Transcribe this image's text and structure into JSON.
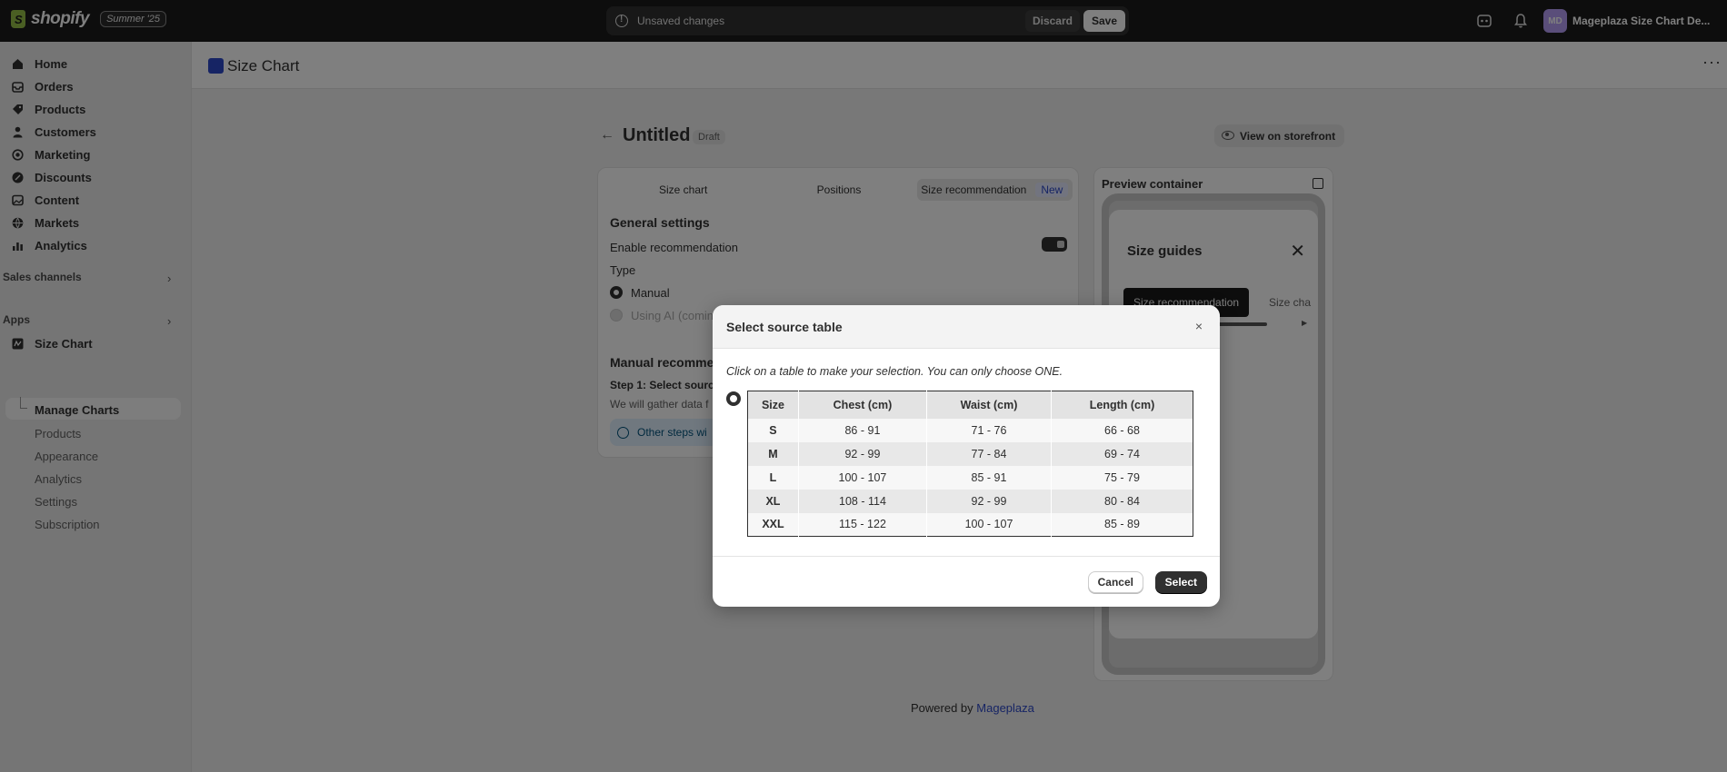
{
  "topbar": {
    "brand": "shopify",
    "edition_badge": "Summer '25",
    "unsaved_message": "Unsaved changes",
    "discard_label": "Discard",
    "save_label": "Save",
    "avatar_initials": "MD",
    "store_name": "Mageplaza Size Chart De..."
  },
  "sidebar": {
    "items": [
      {
        "label": "Home",
        "icon": "home-icon"
      },
      {
        "label": "Orders",
        "icon": "orders-icon"
      },
      {
        "label": "Products",
        "icon": "tag-icon"
      },
      {
        "label": "Customers",
        "icon": "person-icon"
      },
      {
        "label": "Marketing",
        "icon": "target-icon"
      },
      {
        "label": "Discounts",
        "icon": "discount-icon"
      },
      {
        "label": "Content",
        "icon": "image-icon"
      },
      {
        "label": "Markets",
        "icon": "globe-icon"
      },
      {
        "label": "Analytics",
        "icon": "bar-chart-icon"
      }
    ],
    "sales_channels_label": "Sales channels",
    "apps_label": "Apps",
    "app_name": "Size Chart",
    "app_items": [
      "Manage Charts",
      "Products",
      "Appearance",
      "Analytics",
      "Settings",
      "Subscription"
    ]
  },
  "page_header": {
    "title": "Size Chart",
    "more": "···"
  },
  "editor": {
    "title": "Untitled",
    "status": "Draft",
    "view_storefront": "View on storefront",
    "tabs": [
      "Size chart",
      "Positions",
      "Size recommendation"
    ],
    "new_badge": "New",
    "general_settings": "General settings",
    "enable_recommendation": "Enable recommendation",
    "type_label": "Type",
    "type_manual": "Manual",
    "type_ai": "Using AI (comin",
    "manual_title": "Manual recommen",
    "step1": "Step 1: Select sourc",
    "gather_text": "We will gather data f",
    "banner_text": "Other steps wi"
  },
  "preview": {
    "title": "Preview container",
    "guide_title": "Size guides",
    "tab_active": "Size recommendation",
    "tab_other": "Size cha"
  },
  "footer": {
    "powered_prefix": "Powered by",
    "powered_link": "Mageplaza"
  },
  "modal": {
    "title": "Select source table",
    "close": "×",
    "instruction": "Click on a table to make your selection. You can only choose ONE.",
    "table_headers": [
      "Size",
      "Chest (cm)",
      "Waist (cm)",
      "Length (cm)"
    ],
    "table_rows": [
      [
        "S",
        "86 - 91",
        "71 - 76",
        "66 - 68"
      ],
      [
        "M",
        "92 - 99",
        "77 - 84",
        "69 - 74"
      ],
      [
        "L",
        "100 - 107",
        "85 - 91",
        "75 - 79"
      ],
      [
        "XL",
        "108 - 114",
        "92 - 99",
        "80 - 84"
      ],
      [
        "XXL",
        "115 - 122",
        "100 - 107",
        "85 - 89"
      ]
    ],
    "cancel_label": "Cancel",
    "select_label": "Select"
  }
}
